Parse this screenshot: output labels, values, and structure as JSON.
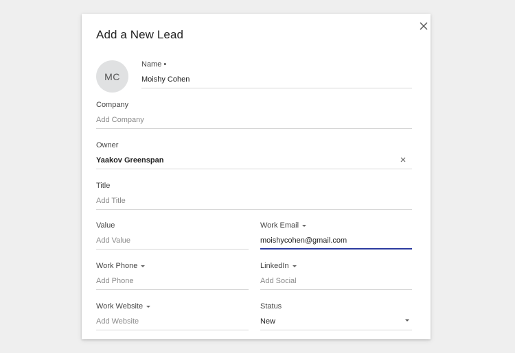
{
  "dialog": {
    "title": "Add a New Lead",
    "close_icon": "close-icon",
    "avatar_initials": "MC"
  },
  "fields": {
    "name": {
      "label": "Name",
      "required_mark": "•",
      "value": "Moishy Cohen"
    },
    "company": {
      "label": "Company",
      "placeholder": "Add Company"
    },
    "owner": {
      "label": "Owner",
      "value": "Yaakov Greenspan"
    },
    "title": {
      "label": "Title",
      "placeholder": "Add Title"
    },
    "value": {
      "label": "Value",
      "placeholder": "Add Value"
    },
    "work_email": {
      "label": "Work Email",
      "value": "moishycohen@gmail.com"
    },
    "work_phone": {
      "label": "Work Phone",
      "placeholder": "Add Phone"
    },
    "linkedin": {
      "label": "LinkedIn",
      "placeholder": "Add Social"
    },
    "work_website": {
      "label": "Work Website",
      "placeholder": "Add Website"
    },
    "status": {
      "label": "Status",
      "value": "New"
    }
  },
  "colors": {
    "active_underline": "#2b3a9f",
    "avatar_bg": "#e0e1e2",
    "backdrop": "#efefef"
  }
}
